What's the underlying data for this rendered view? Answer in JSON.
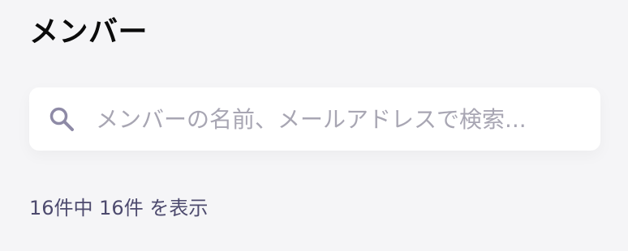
{
  "header": {
    "title": "メンバー"
  },
  "search": {
    "icon": "search-icon",
    "placeholder": "メンバーの名前、メールアドレスで検索...",
    "value": ""
  },
  "results": {
    "summary": "16件中 16件 を表示"
  },
  "colors": {
    "background": "#f5f5f7",
    "card": "#ffffff",
    "icon": "#8e8aa6",
    "placeholder": "#a8a6b3",
    "summary_text": "#4d4a6e"
  }
}
